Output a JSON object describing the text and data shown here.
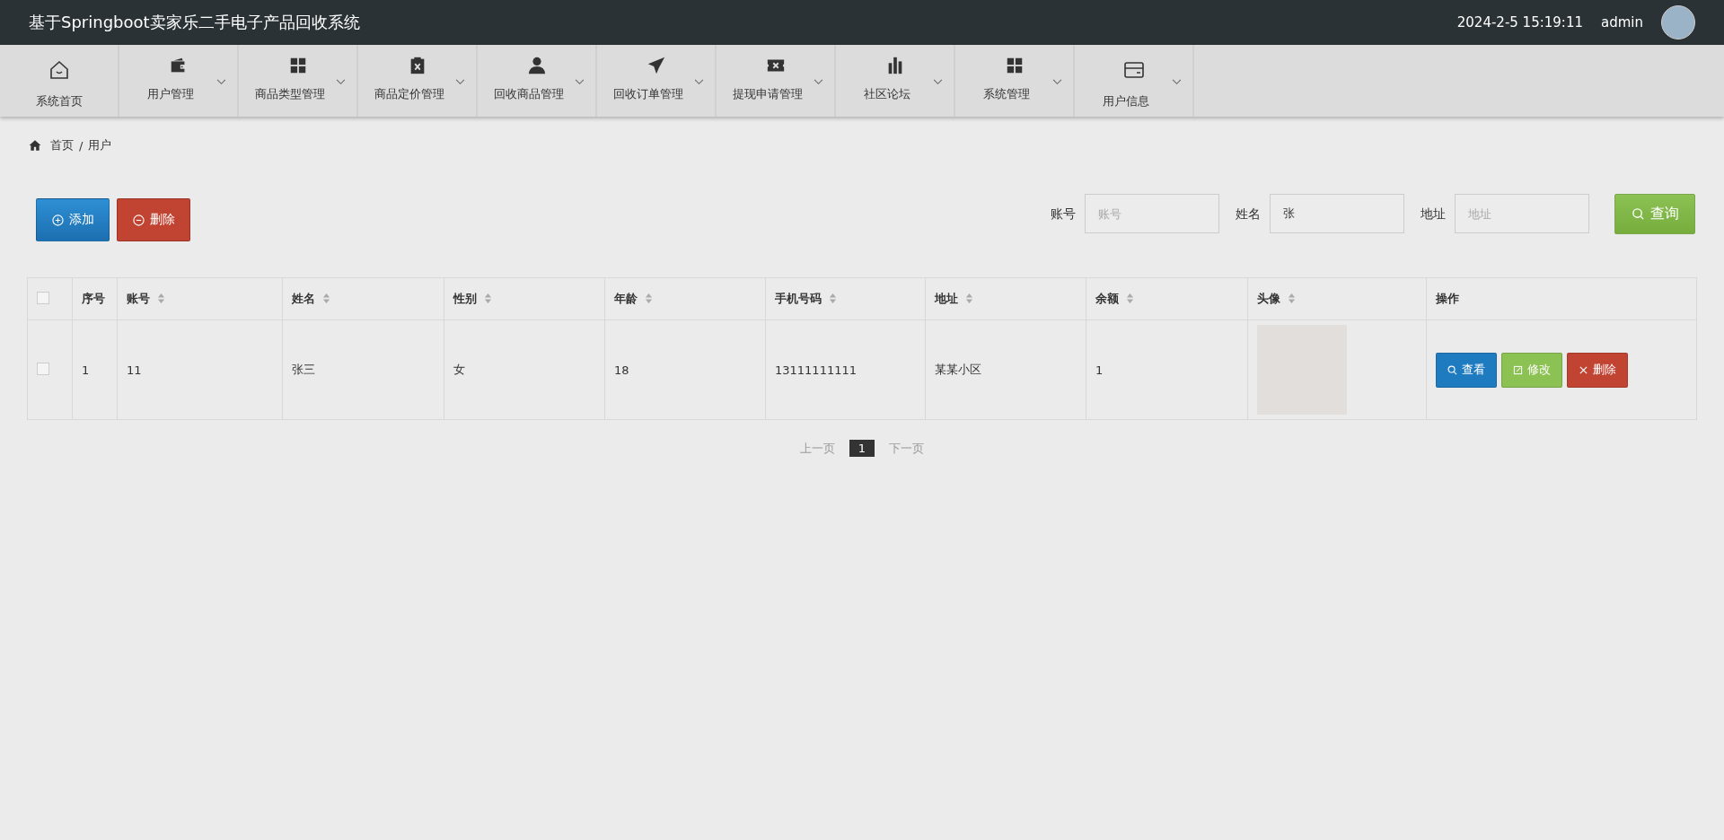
{
  "header": {
    "title": "基于Springboot卖家乐二手电子产品回收系统",
    "datetime": "2024-2-5 15:19:11",
    "user": "admin"
  },
  "nav": [
    {
      "label": "系统首页",
      "kind": "home",
      "dropdown": false
    },
    {
      "label": "用户管理",
      "kind": "wallet",
      "dropdown": true
    },
    {
      "label": "商品类型管理",
      "kind": "grid",
      "dropdown": true
    },
    {
      "label": "商品定价管理",
      "kind": "clipboard",
      "dropdown": true
    },
    {
      "label": "回收商品管理",
      "kind": "person",
      "dropdown": true
    },
    {
      "label": "回收订单管理",
      "kind": "plane",
      "dropdown": true
    },
    {
      "label": "提现申请管理",
      "kind": "ticket",
      "dropdown": true
    },
    {
      "label": "社区论坛",
      "kind": "chart",
      "dropdown": true
    },
    {
      "label": "系统管理",
      "kind": "grid",
      "dropdown": true
    },
    {
      "label": "用户信息",
      "kind": "card",
      "dropdown": true
    }
  ],
  "breadcrumb": {
    "items": [
      "首页",
      "用户"
    ],
    "separator": "/"
  },
  "actions": [
    {
      "label": "添加",
      "kind": "add"
    },
    {
      "label": "删除",
      "kind": "remove"
    }
  ],
  "search": {
    "fields": [
      {
        "label": "账号",
        "placeholder": "账号"
      },
      {
        "label": "姓名",
        "value": "张"
      },
      {
        "label": "地址",
        "placeholder": "地址"
      }
    ],
    "button": "查询"
  },
  "table": {
    "columns": [
      {
        "label": "序号",
        "sortable": false
      },
      {
        "label": "账号",
        "sortable": true
      },
      {
        "label": "姓名",
        "sortable": true
      },
      {
        "label": "性别",
        "sortable": true
      },
      {
        "label": "年龄",
        "sortable": true
      },
      {
        "label": "手机号码",
        "sortable": true
      },
      {
        "label": "地址",
        "sortable": true
      },
      {
        "label": "余额",
        "sortable": true
      },
      {
        "label": "头像",
        "sortable": true
      },
      {
        "label": "操作",
        "sortable": false
      }
    ],
    "header_checked": false,
    "rows": [
      {
        "checked": false,
        "cells": [
          "1",
          "11",
          "张三",
          "女",
          "18",
          "13111111111",
          "某某小区",
          "1"
        ],
        "buttons": [
          {
            "label": "查看",
            "kind": "view"
          },
          {
            "label": "修改",
            "kind": "edit"
          },
          {
            "label": "删除",
            "kind": "delete"
          }
        ]
      }
    ]
  },
  "pagination": {
    "prev": "上一页",
    "pages": [
      {
        "label": "1",
        "selected": true
      }
    ],
    "next": "下一页"
  }
}
